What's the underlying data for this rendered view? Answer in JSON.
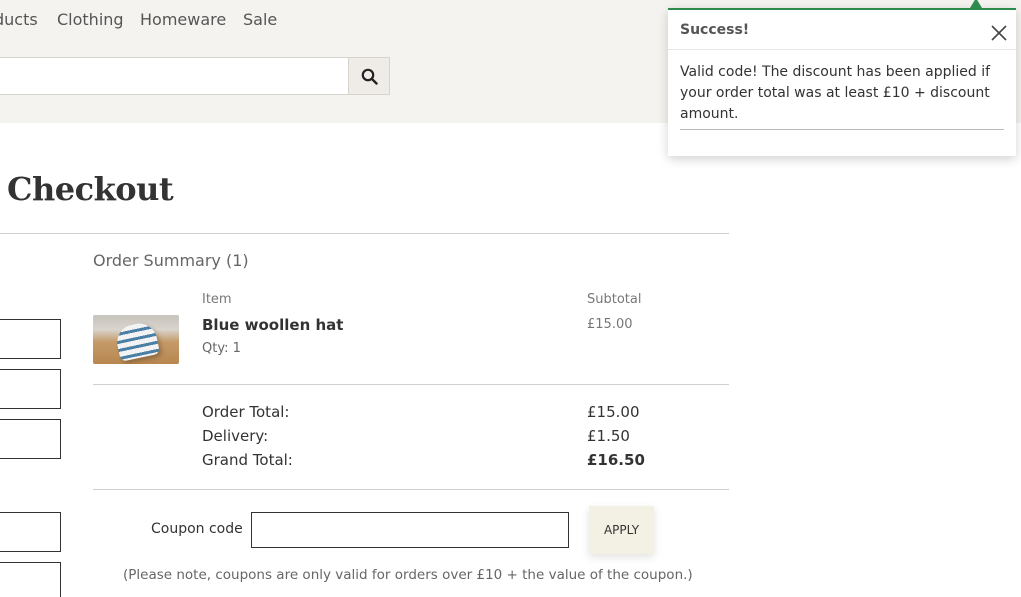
{
  "nav": {
    "items": [
      "ducts",
      "Clothing",
      "Homeware",
      "Sale"
    ]
  },
  "search": {
    "placeholder": ""
  },
  "checkout": {
    "title": "Checkout",
    "summary_heading": "Order Summary (1)",
    "columns": {
      "item": "Item",
      "subtotal": "Subtotal"
    },
    "line_item": {
      "name": "Blue woollen hat",
      "qty": "Qty: 1",
      "price": "£15.00"
    },
    "totals": {
      "order_total_label": "Order Total:",
      "order_total_value": "£15.00",
      "delivery_label": "Delivery:",
      "delivery_value": "£1.50",
      "grand_total_label": "Grand Total:",
      "grand_total_value": "£16.50"
    },
    "coupon": {
      "label": "Coupon code",
      "value": "",
      "apply_label": "APPLY",
      "note": "(Please note, coupons are only valid for orders over £10 + the value of the coupon.)"
    }
  },
  "toast": {
    "title": "Success!",
    "message": "Valid code! The discount has been applied if your order total was at least £10 + discount amount.",
    "accent_color": "#2e8b4e"
  },
  "icons": {
    "search": "search-icon",
    "close": "close-icon"
  }
}
